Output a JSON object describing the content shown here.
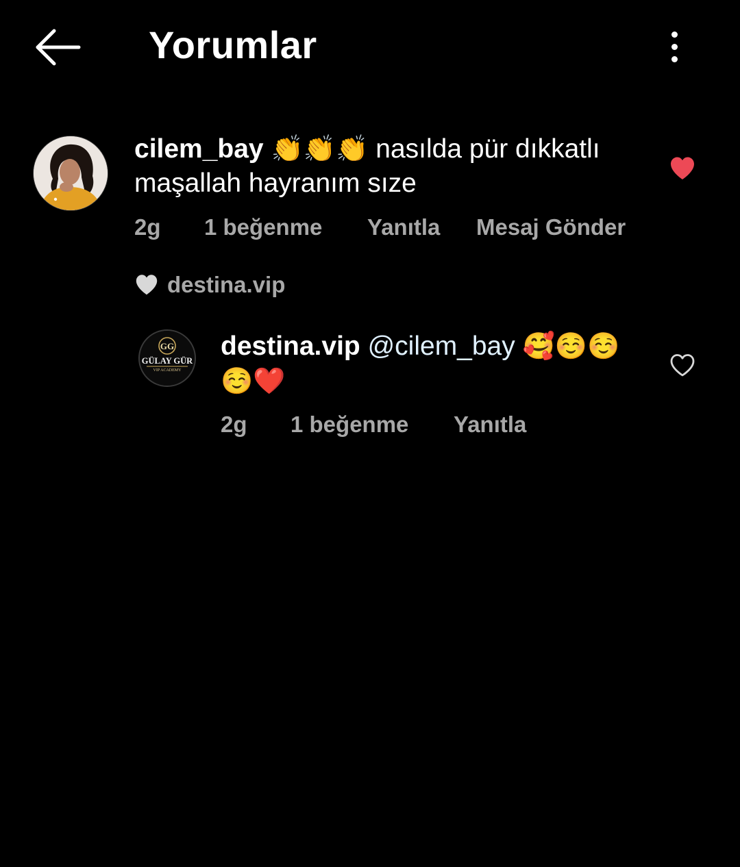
{
  "header": {
    "title": "Yorumlar",
    "back_icon": "arrow-left-icon",
    "more_icon": "more-vertical-icon"
  },
  "comment": {
    "username": "cilem_bay",
    "emojis_1": "👏👏👏",
    "text_1": " nasılda pür dıkkatlı maşallah  hayranım sıze",
    "time": "2g",
    "likes": "1 beğenme",
    "reply": "Yanıtla",
    "send_message": "Mesaj Gönder",
    "liked": true,
    "like_color": "#ed4956"
  },
  "liked_by": {
    "username": "destina.vip",
    "icon": "heart-icon"
  },
  "reply": {
    "username": "destina.vip",
    "mention": "@cilem_bay",
    "emojis": "🥰☺️☺️☺️❤️",
    "avatar_brand": "GÜLAY GÜR",
    "avatar_subtitle": "VIP ACADEMY",
    "avatar_monogram": "GG",
    "time": "2g",
    "likes": "1 beğenme",
    "reply": "Yanıtla",
    "liked": false
  },
  "colors": {
    "background": "#000000",
    "text": "#ffffff",
    "meta": "#a8a8a8",
    "heart_red": "#ed4956"
  }
}
